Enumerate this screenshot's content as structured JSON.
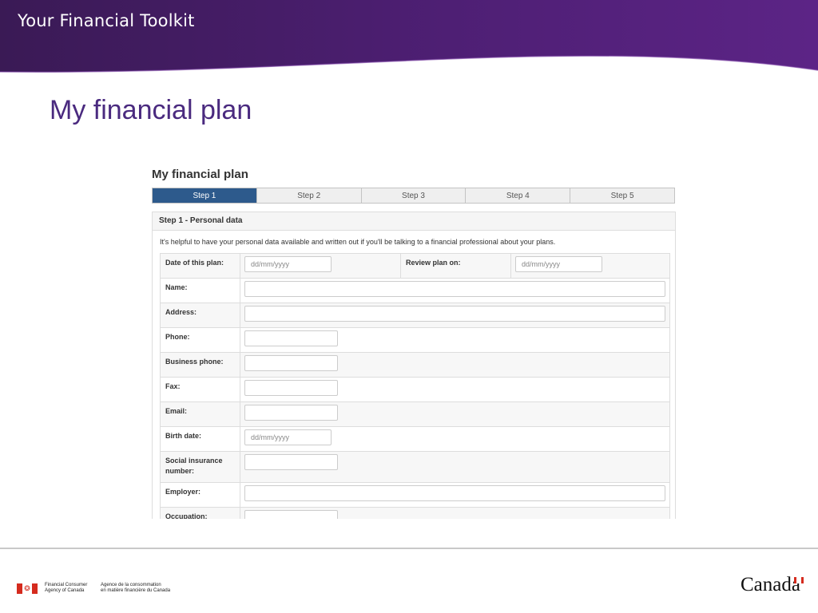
{
  "banner": {
    "title": "Your Financial Toolkit"
  },
  "slide": {
    "title": "My financial plan"
  },
  "form": {
    "title": "My financial plan",
    "steps": [
      {
        "label": "Step 1",
        "active": true
      },
      {
        "label": "Step 2",
        "active": false
      },
      {
        "label": "Step 3",
        "active": false
      },
      {
        "label": "Step 4",
        "active": false
      },
      {
        "label": "Step 5",
        "active": false
      }
    ],
    "panel_heading": "Step 1 - Personal data",
    "intro": "It's helpful to have your personal data available and written out if you'll be talking to a financial professional about your plans.",
    "fields": {
      "date_of_plan": {
        "label": "Date of this plan:",
        "placeholder": "dd/mm/yyyy"
      },
      "review_plan_on": {
        "label": "Review plan on:",
        "placeholder": "dd/mm/yyyy"
      },
      "name": {
        "label": "Name:"
      },
      "address": {
        "label": "Address:"
      },
      "phone": {
        "label": "Phone:"
      },
      "business_phone": {
        "label": "Business phone:"
      },
      "fax": {
        "label": "Fax:"
      },
      "email": {
        "label": "Email:"
      },
      "birth_date": {
        "label": "Birth date:",
        "placeholder": "dd/mm/yyyy"
      },
      "sin": {
        "label": "Social insurance number:"
      },
      "employer": {
        "label": "Employer:"
      },
      "occupation": {
        "label": "Occupation:"
      }
    }
  },
  "footer": {
    "agency_en": [
      "Financial Consumer",
      "Agency of Canada"
    ],
    "agency_fr": [
      "Agence de la consommation",
      "en matière financière du Canada"
    ],
    "wordmark": "Canada"
  },
  "colors": {
    "banner_purple": "#4e1f74",
    "title_purple": "#4a2a7f",
    "active_step": "#2d5a8c",
    "flag_red": "#d52b1e"
  }
}
